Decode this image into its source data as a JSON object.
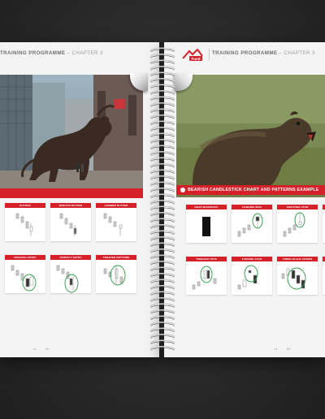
{
  "left_page": {
    "header": {
      "title": "TRAINING PROGRAMME",
      "subtitle": " – CHAPTER 3"
    },
    "cards_row1": [
      "BUYPEN",
      "INVESTR BUYPER",
      "HAMMER BUYPER"
    ],
    "cards_row2": [
      "PIERCING ENTRY",
      "PERFECT ENTRY",
      "TWEEZER BOTTOMS"
    ],
    "footer": "52"
  },
  "right_page": {
    "header": {
      "title": "TRAINING PROGRAMME",
      "subtitle": " – CHAPTER 3"
    },
    "logo_text": "Fund",
    "banner": "BEARISH CANDLESTICK CHART AND PATTERNS EXAMPLE",
    "cards_row1": [
      "BEAR MARUBOZU",
      "HANGING MAN",
      "SHOOTING STAR"
    ],
    "cards_row2": [
      "TWEEZER TOPS",
      "EVENING STAR",
      "THREE BLACK CROWS"
    ],
    "footer": "53"
  },
  "colors": {
    "accent": "#d5202a",
    "background": "#2b2b2b",
    "paper": "#f4f4f4"
  }
}
